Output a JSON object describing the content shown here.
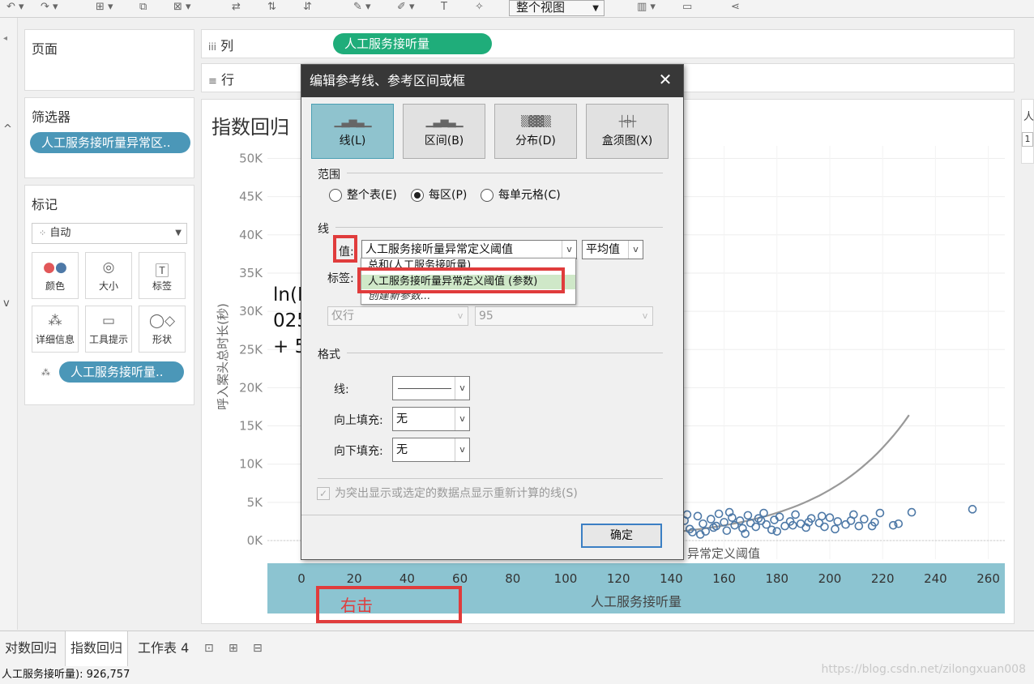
{
  "toolbar": {
    "view_mode": "整个视图"
  },
  "shelves": {
    "pages_label": "页面",
    "columns_label": "列",
    "columns_icon": "columns-icon",
    "columns_pill": "人工服务接听量",
    "rows_label": "行",
    "rows_icon": "rows-icon"
  },
  "filters": {
    "label": "筛选器",
    "pill": "人工服务接听量异常区.."
  },
  "marks": {
    "label": "标记",
    "type": "自动",
    "buttons": [
      {
        "label": "颜色",
        "icon": "color-icon"
      },
      {
        "label": "大小",
        "icon": "size-icon"
      },
      {
        "label": "标签",
        "icon": "label-icon"
      },
      {
        "label": "详细信息",
        "icon": "detail-icon"
      },
      {
        "label": "工具提示",
        "icon": "tooltip-icon"
      },
      {
        "label": "形状",
        "icon": "shape-icon"
      }
    ],
    "detail_pill": "人工服务接听量.."
  },
  "sheet": {
    "title": "指数回归",
    "equation_lines": [
      "ln(I",
      "025",
      "+ 5"
    ],
    "right_hint": "异常定义阈值",
    "annotation": "右击",
    "accent": "#4e79a7",
    "axis_band": "#8cc4d1"
  },
  "chart_data": {
    "type": "scatter",
    "xlabel": "人工服务接听量",
    "ylabel": "呼入案头总时长(秒)",
    "x_ticks": [
      "0",
      "20",
      "40",
      "60",
      "80",
      "100",
      "120",
      "140",
      "160",
      "180",
      "200",
      "220",
      "240",
      "260"
    ],
    "y_ticks": [
      "0K",
      "5K",
      "10K",
      "15K",
      "20K",
      "25K",
      "30K",
      "35K",
      "40K",
      "45K",
      "50K"
    ],
    "xlim": [
      -5,
      265
    ],
    "ylim": [
      0,
      50000
    ],
    "points": [
      [
        140,
        2100
      ],
      [
        142,
        1800
      ],
      [
        145,
        2600
      ],
      [
        147,
        1500
      ],
      [
        150,
        3200
      ],
      [
        152,
        2200
      ],
      [
        153,
        1200
      ],
      [
        155,
        2800
      ],
      [
        157,
        1900
      ],
      [
        158,
        3500
      ],
      [
        160,
        2400
      ],
      [
        161,
        1300
      ],
      [
        163,
        3000
      ],
      [
        164,
        2000
      ],
      [
        166,
        2600
      ],
      [
        167,
        1600
      ],
      [
        169,
        3300
      ],
      [
        170,
        2300
      ],
      [
        172,
        1800
      ],
      [
        173,
        2900
      ],
      [
        175,
        3600
      ],
      [
        176,
        2100
      ],
      [
        178,
        1400
      ],
      [
        179,
        2700
      ],
      [
        181,
        3100
      ],
      [
        183,
        1900
      ],
      [
        185,
        2500
      ],
      [
        187,
        3400
      ],
      [
        189,
        2200
      ],
      [
        191,
        1700
      ],
      [
        193,
        2900
      ],
      [
        196,
        2300
      ],
      [
        198,
        1800
      ],
      [
        200,
        3000
      ],
      [
        203,
        2500
      ],
      [
        206,
        2100
      ],
      [
        209,
        3400
      ],
      [
        213,
        2800
      ],
      [
        216,
        1900
      ],
      [
        219,
        3600
      ],
      [
        224,
        2000
      ],
      [
        226,
        2200
      ],
      [
        231,
        3700
      ],
      [
        254,
        4100
      ],
      [
        143,
        2900
      ],
      [
        148,
        1100
      ],
      [
        156,
        1700
      ],
      [
        162,
        3700
      ],
      [
        168,
        900
      ],
      [
        174,
        2600
      ],
      [
        180,
        1200
      ],
      [
        186,
        2000
      ],
      [
        192,
        2400
      ],
      [
        197,
        3200
      ],
      [
        202,
        1500
      ],
      [
        208,
        2600
      ],
      [
        211,
        1900
      ],
      [
        217,
        2400
      ],
      [
        146,
        3400
      ],
      [
        151,
        800
      ]
    ],
    "trend_curve": "exponential",
    "trend_a": 15.8,
    "trend_b": 0.0302
  },
  "tabs": {
    "items": [
      "对数回归",
      "指数回归",
      "工作表 4"
    ],
    "active": "指数回归",
    "new_icons": [
      "new-sheet-icon",
      "new-dashboard-icon",
      "new-story-icon"
    ]
  },
  "status": {
    "text": "人工服务接听量): 926,757"
  },
  "watermark": "https://blog.csdn.net/zilongxuan008",
  "dialog": {
    "title": "编辑参考线、参考区间或框",
    "types": [
      "线(L)",
      "区间(B)",
      "分布(D)",
      "盒须图(X)"
    ],
    "active_type": "线(L)",
    "scope_label": "范围",
    "scope_options": [
      "整个表(E)",
      "每区(P)",
      "每单元格(C)"
    ],
    "scope_selected": "每区(P)",
    "line_label": "线",
    "value_label": "值:",
    "value_selected": "人工服务接听量异常定义阈值",
    "aggregation": "平均值",
    "label_label": "标签:",
    "dropdown_items": [
      "总和(人工服务接听量)",
      "人工服务接听量异常定义阈值 (参数)",
      "创建新参数..."
    ],
    "tooltip_sel": "仅行",
    "confidence": "95",
    "format_label": "格式",
    "line_fmt_label": "线:",
    "fill_up_label": "向上填充:",
    "fill_up_value": "无",
    "fill_down_label": "向下填充:",
    "fill_down_value": "无",
    "recalc_label": "为突出显示或选定的数据点显示重新计算的线(S)",
    "ok_label": "确定"
  }
}
